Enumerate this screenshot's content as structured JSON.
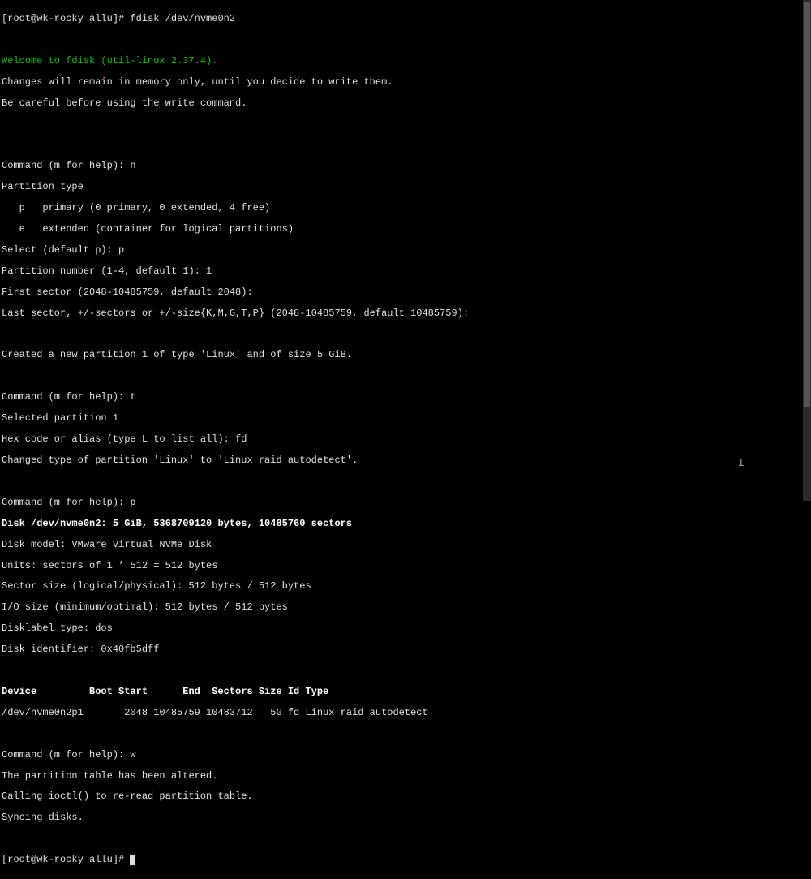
{
  "prompt1": "[root@wk-rocky allu]# fdisk /dev/nvme0n2",
  "welcome": "Welcome to fdisk (util-linux 2.37.4).",
  "intro1": "Changes will remain in memory only, until you decide to write them.",
  "intro2": "Be careful before using the write command.",
  "cmd_n": "Command (m for help): n",
  "ptype": "Partition type",
  "ptype_p": "   p   primary (0 primary, 0 extended, 4 free)",
  "ptype_e": "   e   extended (container for logical partitions)",
  "select_p": "Select (default p): p",
  "partnum": "Partition number (1-4, default 1): 1",
  "firstsec": "First sector (2048-10485759, default 2048):",
  "lastsec": "Last sector, +/-sectors or +/-size{K,M,G,T,P} (2048-10485759, default 10485759):",
  "created": "Created a new partition 1 of type 'Linux' and of size 5 GiB.",
  "cmd_t": "Command (m for help): t",
  "selpart": "Selected partition 1",
  "hexcode": "Hex code or alias (type L to list all): fd",
  "changed": "Changed type of partition 'Linux' to 'Linux raid autodetect'.",
  "cmd_p": "Command (m for help): p",
  "diskline": "Disk /dev/nvme0n2: 5 GiB, 5368709120 bytes, 10485760 sectors",
  "model": "Disk model: VMware Virtual NVMe Disk",
  "units": "Units: sectors of 1 * 512 = 512 bytes",
  "secsize": "Sector size (logical/physical): 512 bytes / 512 bytes",
  "iosize": "I/O size (minimum/optimal): 512 bytes / 512 bytes",
  "dlabel": "Disklabel type: dos",
  "diskid": "Disk identifier: 0x40fb5dff",
  "tblhdr": "Device         Boot Start      End  Sectors Size Id Type",
  "tblrow": "/dev/nvme0n2p1       2048 10485759 10483712   5G fd Linux raid autodetect",
  "cmd_w": "Command (m for help): w",
  "altered": "The partition table has been altered.",
  "ioctl": "Calling ioctl() to re-read partition table.",
  "syncing": "Syncing disks.",
  "prompt2": "[root@wk-rocky allu]# "
}
